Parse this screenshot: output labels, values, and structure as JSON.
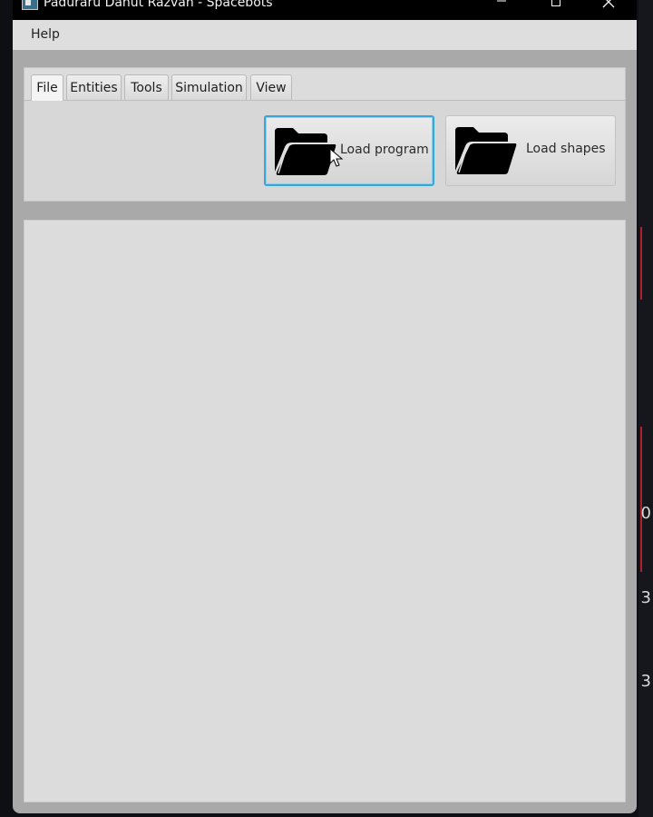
{
  "window": {
    "title": "Paduraru Danut Razvan - Spacebots",
    "controls": {
      "minimize_glyph": "─",
      "maximize_glyph": "☐",
      "close_glyph": "✕"
    }
  },
  "menubar": {
    "items": [
      {
        "label": "Help"
      }
    ]
  },
  "tabs": [
    {
      "label": "File",
      "selected": true
    },
    {
      "label": "Entities",
      "selected": false
    },
    {
      "label": "Tools",
      "selected": false
    },
    {
      "label": "Simulation",
      "selected": false
    },
    {
      "label": "View",
      "selected": false
    }
  ],
  "file_tab": {
    "buttons": [
      {
        "label": "Load program",
        "icon": "folder-open-icon",
        "focused": true
      },
      {
        "label": "Load shapes",
        "icon": "folder-open-icon",
        "focused": false
      }
    ]
  },
  "background_glyphs": [
    "0",
    "3",
    "3"
  ],
  "colors": {
    "focus_border": "#39a6d8",
    "titlebar": "#000000",
    "panel": "#dcdcdc",
    "window_frame": "#a9a9a9"
  }
}
